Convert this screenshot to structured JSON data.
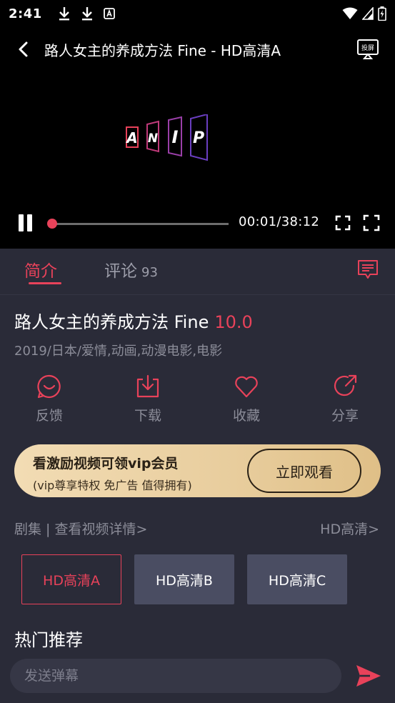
{
  "status_bar": {
    "time": "2:41"
  },
  "player": {
    "title": "路人女主的养成方法 Fine - HD高清A",
    "cast_label": "投屏",
    "logo_letters": [
      "A",
      "N",
      "I",
      "P"
    ],
    "current_time": "00:01",
    "duration": "38:12",
    "time_display": "00:01/38:12",
    "progress_fraction": 0.0004
  },
  "tabs": [
    {
      "label": "简介",
      "active": true
    },
    {
      "label": "评论",
      "count": "93",
      "active": false
    }
  ],
  "info": {
    "title": "路人女主的养成方法 Fine",
    "rating": "10.0",
    "meta": "2019/日本/爱情,动画,动漫电影,电影"
  },
  "actions": [
    {
      "label": "反馈",
      "icon": "feedback-icon"
    },
    {
      "label": "下载",
      "icon": "download-icon"
    },
    {
      "label": "收藏",
      "icon": "heart-icon"
    },
    {
      "label": "分享",
      "icon": "share-icon"
    }
  ],
  "vip": {
    "title": "看激励视频可领vip会员",
    "subtitle": "(vip尊享特权 免广告 值得拥有)",
    "button": "立即观看"
  },
  "episodes": {
    "header_left": "剧集 | 查看视频详情>",
    "header_right": "HD高清>",
    "items": [
      "HD高清A",
      "HD高清B",
      "HD高清C"
    ],
    "selected": 0
  },
  "recommend_title": "热门推荐",
  "danmaku": {
    "placeholder": "发送弹幕"
  },
  "colors": {
    "accent": "#e8425a",
    "background": "#2a2b38",
    "player_bg": "#000000",
    "muted_text": "#8c8d99",
    "episode_bg": "#4a4d62",
    "vip_gold": "#e8cd9d"
  }
}
